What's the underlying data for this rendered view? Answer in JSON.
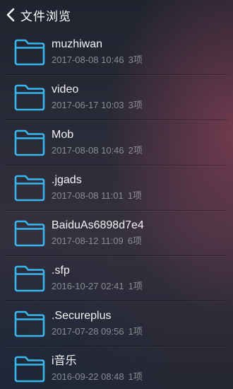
{
  "header": {
    "title": "文件浏览"
  },
  "accent_color": "#38b6ee",
  "files": [
    {
      "name": "muzhiwan",
      "date": "2017-08-08 10:46",
      "count": "3项"
    },
    {
      "name": "video",
      "date": "2017-06-17 10:03",
      "count": "3项"
    },
    {
      "name": "Mob",
      "date": "2017-08-08 10:46",
      "count": "2项"
    },
    {
      "name": ".jgads",
      "date": "2017-08-08 11:01",
      "count": "1项"
    },
    {
      "name": "BaiduAs6898d7e4",
      "date": "2017-08-12 11:09",
      "count": "6项"
    },
    {
      "name": ".sfp",
      "date": "2016-10-27 02:41",
      "count": "1项"
    },
    {
      "name": ".Secureplus",
      "date": "2017-07-28 09:56",
      "count": "1项"
    },
    {
      "name": "i音乐",
      "date": "2016-09-22 08:48",
      "count": "1项"
    }
  ]
}
